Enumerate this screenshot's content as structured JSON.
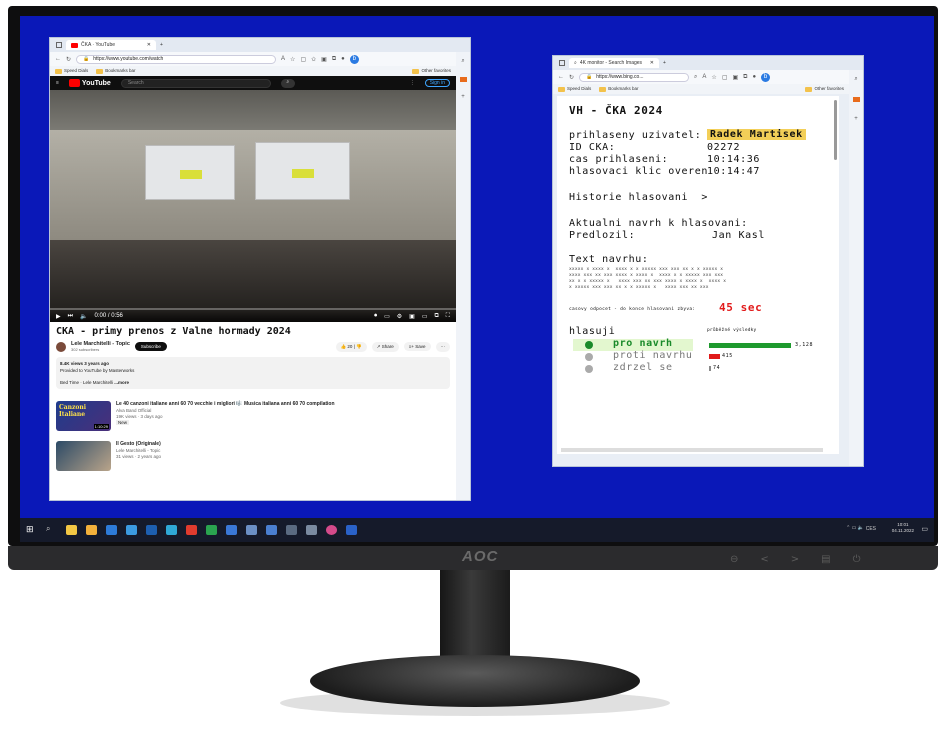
{
  "monitor": {
    "brand": "AOC",
    "buttons": [
      "⊖",
      "<",
      ">",
      "▤",
      "⏻"
    ]
  },
  "yt_window": {
    "tab_title": "ČKA · YouTube",
    "url": "https://www.youtube.com/watch",
    "fav_speed_dials": "Speed Dials",
    "fav_bookmarks": "Bookmarks bar",
    "fav_other": "Other favorites",
    "yt_logo": "YouTube",
    "search_placeholder": "Search",
    "sign_in": "Sign in",
    "time": "0:00 / 0:56",
    "title": "CKA - primy prenos z Valne hormady 2024",
    "channel": "Lele Marchitelli - Topic",
    "subscribers": "302 subscribers",
    "subscribe": "Subscribe",
    "likes": "20",
    "share": "Share",
    "save": "Save",
    "desc_line1": "8.4K views  3 years ago",
    "desc_line2": "Provided to YouTube by Masterworks",
    "desc_line3": "Bed Time · Lele Marchitelli",
    "desc_more": "...more",
    "recs": [
      {
        "title": "Le 40 canzoni italiane anni 60 70 vecchie i migliori 🎼 Musica italiana anni 60 70 compilation",
        "channel": "Alva Band Official",
        "meta": "19K views · 3 days ago",
        "badge": "New",
        "duration": "1:10:29",
        "thumb_text": "Canzoni Italiane"
      },
      {
        "title": "Il Gesto (Originale)",
        "channel": "Lele Marchitelli - Topic",
        "meta": "31 views · 2 years ago",
        "badge": "",
        "duration": "",
        "thumb_text": ""
      }
    ]
  },
  "vh_window": {
    "tab_title": "4K monitor - Search Images",
    "url": "https://www.bing.co...",
    "fav_speed_dials": "Speed Dials",
    "fav_bookmarks": "Bookmarks bar",
    "fav_other": "Other favorites",
    "heading": "VH - ČKA 2024",
    "rows": [
      {
        "label": "prihlaseny uzivatel:",
        "value": "Radek Martisek"
      },
      {
        "label": "ID CKA:",
        "value": "02272"
      },
      {
        "label": "cas prihlaseni:",
        "value": "10:14:36"
      },
      {
        "label": "hlasovaci klic overen",
        "value": "10:14:47"
      }
    ],
    "history_link": "Historie hlasovani  >",
    "current_motion": "Aktualni navrh k hlasovani:",
    "proposer_label": "Predlozil:",
    "proposer": "Jan Kasl",
    "text_label": "Text navrhu:",
    "countdown_label": "casovy odpocet - do konce hlasovani zbyva:",
    "countdown_value": "45 sec",
    "vote_label": "hlasuji",
    "prelim_label": "průběžné výsledky",
    "options": [
      {
        "label": "pro navrh",
        "count": "3,128",
        "value": 3128,
        "color": "#1e9a2e",
        "selected": true
      },
      {
        "label": "proti navrhu",
        "count": "415",
        "value": 415,
        "color": "#e01a1a",
        "selected": false
      },
      {
        "label": "zdrzel se",
        "count": "74",
        "value": 74,
        "color": "#8a8a8a",
        "selected": false
      }
    ]
  },
  "taskbar": {
    "time": "10:01",
    "date": "04.11.2022",
    "lang": "CES"
  }
}
